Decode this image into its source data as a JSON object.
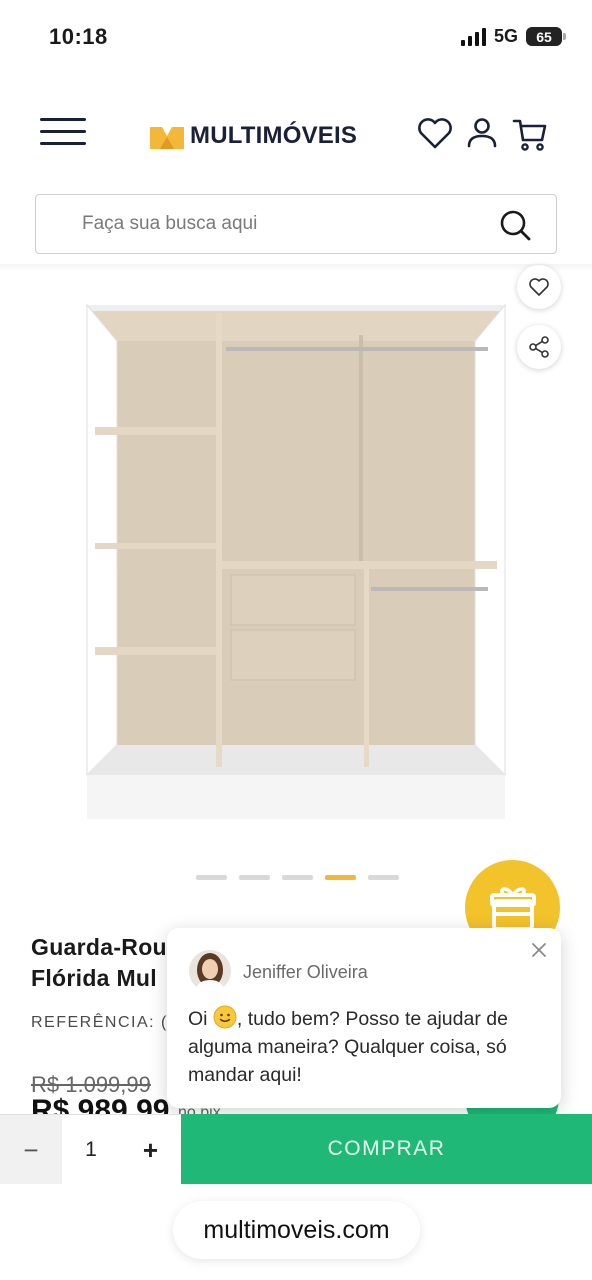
{
  "status_bar": {
    "time": "10:18",
    "network": "5G",
    "battery": "65"
  },
  "header": {
    "brand": "MULTIMÓVEIS",
    "icons": [
      "menu-icon",
      "heart-icon",
      "user-icon",
      "cart-icon"
    ]
  },
  "search": {
    "placeholder": "Faça sua busca aqui",
    "value": ""
  },
  "carousel": {
    "slide_count": 5,
    "active_index": 3
  },
  "product": {
    "title_line1": "Guarda-Rou",
    "title_line2": "Flórida Mul",
    "reference_label": "REFERÊNCIA: (",
    "old_price": "R$ 1.099,99",
    "price": "R$ 989,99",
    "price_note": "no pix"
  },
  "chat": {
    "agent_name": "Jeniffer Oliveira",
    "message_before_emoji": "Oi ",
    "message_after_emoji": ", tudo bem? Posso te ajudar de alguma maneira? Qualquer coisa, só mandar aqui!"
  },
  "purchase": {
    "minus_label": "−",
    "quantity": "1",
    "plus_label": "+",
    "buy_label": "COMPRAR"
  },
  "browser": {
    "url": "multimoveis.com"
  },
  "colors": {
    "brand_navy": "#1a1f3a",
    "brand_yellow": "#f3b73a",
    "buy_green": "#1fb876",
    "gift_yellow": "#f3c32c"
  }
}
